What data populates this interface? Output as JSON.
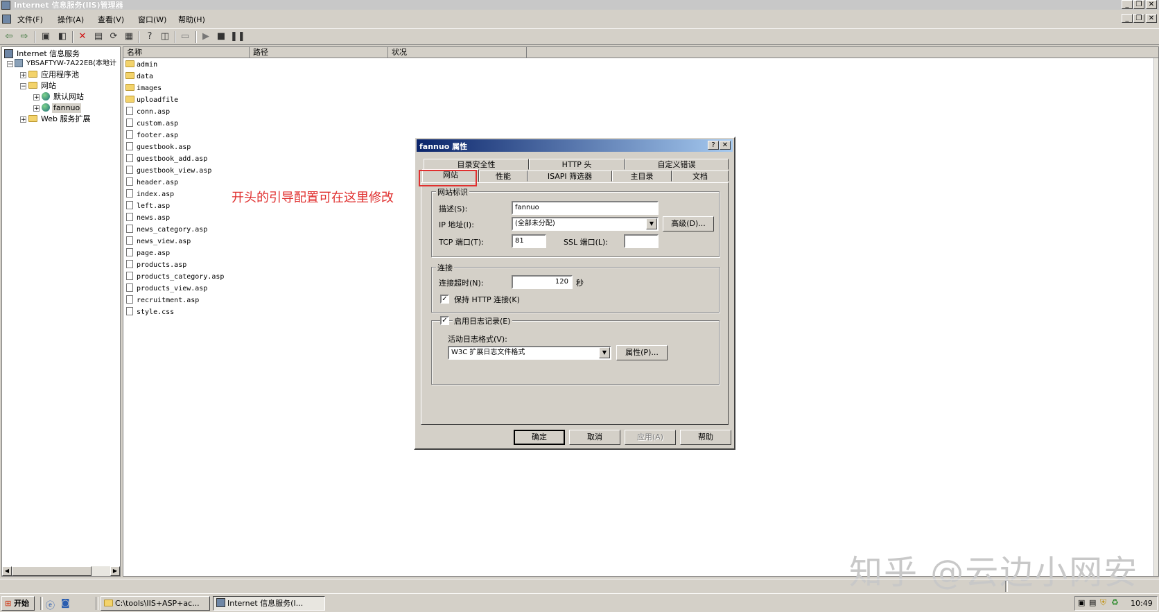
{
  "window": {
    "title": "Internet 信息服务(IIS)管理器"
  },
  "menu": [
    "文件(F)",
    "操作(A)",
    "查看(V)",
    "窗口(W)",
    "帮助(H)"
  ],
  "tree": {
    "root": "Internet 信息服务",
    "server": "YBSAFTYW-7A22EB(本地计",
    "app_pools": "应用程序池",
    "websites": "网站",
    "default_site": "默认网站",
    "fannuo": "fannuo",
    "web_ext": "Web 服务扩展"
  },
  "list": {
    "columns": [
      "名称",
      "路径",
      "状况"
    ],
    "folders": [
      "admin",
      "data",
      "images",
      "uploadfile"
    ],
    "files": [
      "conn.asp",
      "custom.asp",
      "footer.asp",
      "guestbook.asp",
      "guestbook_add.asp",
      "guestbook_view.asp",
      "header.asp",
      "index.asp",
      "left.asp",
      "news.asp",
      "news_category.asp",
      "news_view.asp",
      "page.asp",
      "products.asp",
      "products_category.asp",
      "products_view.asp",
      "recruitment.asp",
      "style.css"
    ]
  },
  "annotation": "开头的引导配置可在这里修改",
  "dialog": {
    "title": "fannuo 属性",
    "help_btn": "?",
    "close_btn": "✕",
    "tabs_row1": [
      "目录安全性",
      "HTTP 头",
      "自定义错误"
    ],
    "tabs_row2": [
      "网站",
      "性能",
      "ISAPI 筛选器",
      "主目录",
      "文档"
    ],
    "identity": {
      "group": "网站标识",
      "desc_label": "描述(S):",
      "desc_value": "fannuo",
      "ip_label": "IP 地址(I):",
      "ip_value": "(全部未分配)",
      "advanced_btn": "高级(D)...",
      "tcp_label": "TCP 端口(T):",
      "tcp_value": "81",
      "ssl_label": "SSL 端口(L):",
      "ssl_value": ""
    },
    "connection": {
      "group": "连接",
      "timeout_label": "连接超时(N):",
      "timeout_value": "120",
      "timeout_unit": "秒",
      "keepalive_label": "保持 HTTP 连接(K)",
      "keepalive_checked": true
    },
    "logging": {
      "enable_label": "启用日志记录(E)",
      "enable_checked": true,
      "format_label": "活动日志格式(V):",
      "format_value": "W3C 扩展日志文件格式",
      "props_btn": "属性(P)..."
    },
    "buttons": {
      "ok": "确定",
      "cancel": "取消",
      "apply": "应用(A)",
      "help": "帮助"
    }
  },
  "taskbar": {
    "start": "开始",
    "items": [
      "C:\\tools\\IIS+ASP+ac...",
      "Internet 信息服务(I..."
    ],
    "clock": "10:49"
  },
  "watermark": "知乎 @云边小网安",
  "colors": {
    "accent": "#0a246a",
    "annotation": "#e0302f"
  }
}
